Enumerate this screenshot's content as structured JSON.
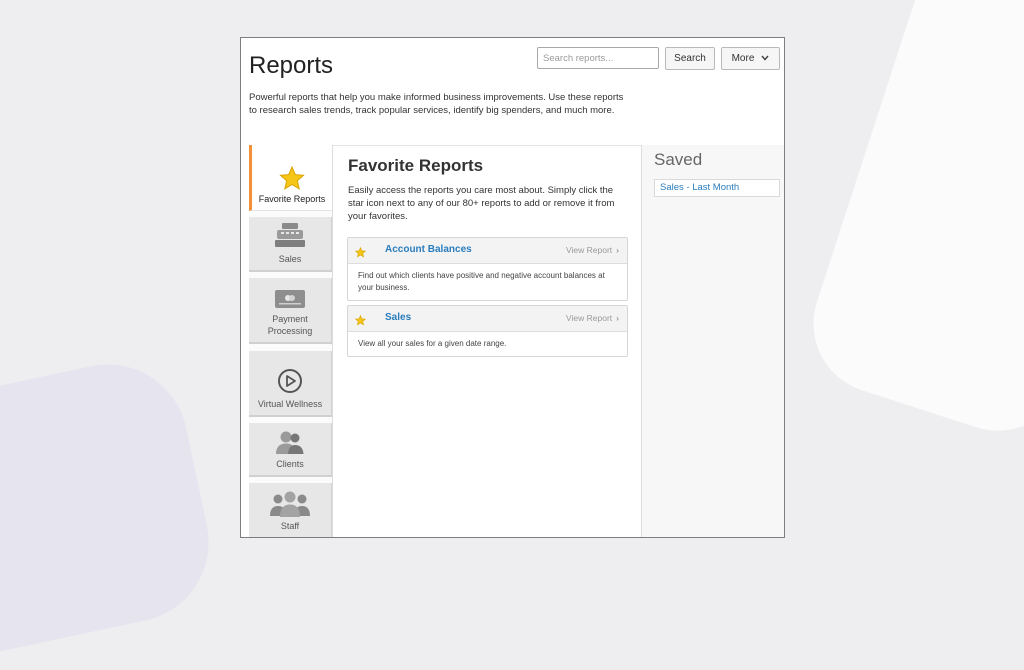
{
  "header": {
    "title": "Reports",
    "description": "Powerful reports that help you make informed business improvements. Use these reports to research sales trends, track popular services, identify big spenders, and much more.",
    "search_placeholder": "Search reports...",
    "search_label": "Search",
    "more_label": "More"
  },
  "tabs": [
    {
      "label": "Favorite Reports",
      "icon": "star-icon",
      "active": true
    },
    {
      "label": "Sales",
      "icon": "cash-register-icon"
    },
    {
      "label": "Payment Processing",
      "icon": "credit-card-icon"
    },
    {
      "label": "Virtual Wellness",
      "icon": "play-circle-icon"
    },
    {
      "label": "Clients",
      "icon": "clients-icon"
    },
    {
      "label": "Staff",
      "icon": "staff-icon"
    }
  ],
  "main": {
    "title": "Favorite Reports",
    "description": "Easily access the reports you care most about. Simply click the star icon next to any of our 80+ reports to add or remove it from your favorites.",
    "cards": [
      {
        "title": "Account Balances",
        "view_label": "View Report",
        "description": "Find out which clients have positive and negative account balances at your business."
      },
      {
        "title": "Sales",
        "view_label": "View Report",
        "description": "View all your sales for a given date range."
      }
    ]
  },
  "saved": {
    "title": "Saved",
    "items": [
      "Sales - Last Month"
    ]
  },
  "colors": {
    "accent": "#f2913a",
    "link": "#2a7dbd",
    "star": "#f5c518"
  }
}
